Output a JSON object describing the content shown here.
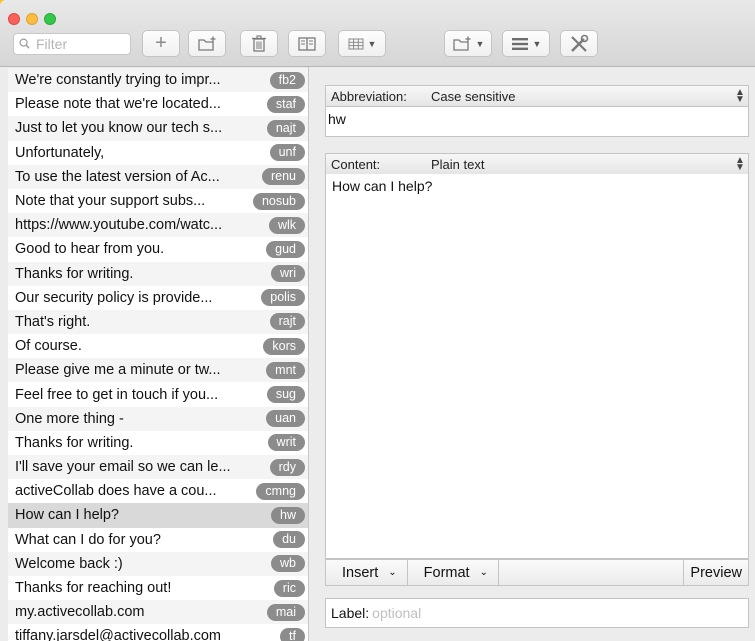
{
  "toolbar": {
    "filter_placeholder": "Filter"
  },
  "snippets": [
    {
      "text": "We're constantly trying to impr...",
      "abbr": "fb2"
    },
    {
      "text": "Please note that we're located...",
      "abbr": "staf"
    },
    {
      "text": "Just to let you know our tech s...",
      "abbr": "najt"
    },
    {
      "text": "Unfortunately,",
      "abbr": "unf"
    },
    {
      "text": "To use the latest version of Ac...",
      "abbr": "renu"
    },
    {
      "text": "Note that your support subs...",
      "abbr": "nosub"
    },
    {
      "text": "https://www.youtube.com/watc...",
      "abbr": "wlk"
    },
    {
      "text": "Good to hear from you.",
      "abbr": "gud"
    },
    {
      "text": "Thanks for writing.",
      "abbr": "wri"
    },
    {
      "text": "Our security policy is provide...",
      "abbr": "polis"
    },
    {
      "text": "That's right.",
      "abbr": "rajt"
    },
    {
      "text": "Of course.",
      "abbr": "kors"
    },
    {
      "text": "Please give me a minute or tw...",
      "abbr": "mnt"
    },
    {
      "text": "Feel free to get in touch if you...",
      "abbr": "sug"
    },
    {
      "text": "One more thing -",
      "abbr": "uan"
    },
    {
      "text": "Thanks for writing.",
      "abbr": "writ"
    },
    {
      "text": "I'll save your email so we can le...",
      "abbr": "rdy"
    },
    {
      "text": "activeCollab does have a cou...",
      "abbr": "cmng"
    },
    {
      "text": "How can I help?",
      "abbr": "hw",
      "selected": true
    },
    {
      "text": "What can I do for you?",
      "abbr": "du"
    },
    {
      "text": "Welcome back :)",
      "abbr": "wb"
    },
    {
      "text": "Thanks for reaching out!",
      "abbr": "ric"
    },
    {
      "text": "my.activecollab.com",
      "abbr": "mai"
    },
    {
      "text": "tiffany.jarsdel@activecollab.com",
      "abbr": "tf"
    }
  ],
  "abbreviation": {
    "label": "Abbreviation:",
    "mode": "Case sensitive",
    "value": "hw"
  },
  "content": {
    "label": "Content:",
    "mode": "Plain text",
    "value": "How can I help?"
  },
  "bottom_bar": {
    "insert": "Insert",
    "format": "Format",
    "preview": "Preview"
  },
  "label_field": {
    "label": "Label:",
    "placeholder": "optional"
  },
  "colors": {
    "background": "#fcc21b",
    "badge": "#8c8c8c",
    "selected_row": "#d9d9d9"
  }
}
